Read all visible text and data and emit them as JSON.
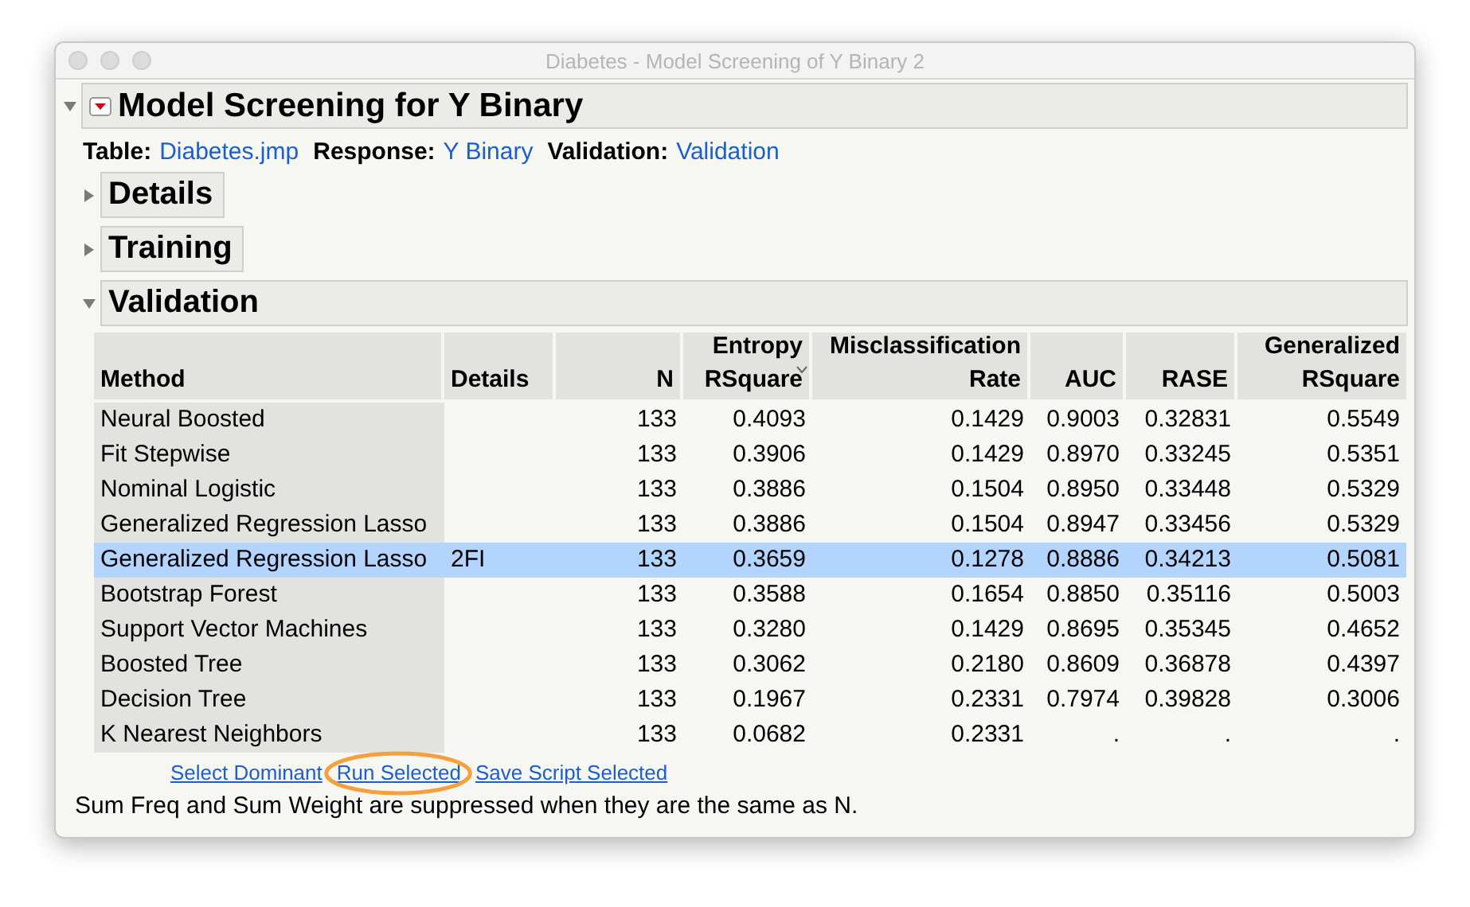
{
  "window": {
    "title": "Diabetes - Model Screening of Y Binary 2"
  },
  "report": {
    "title": "Model Screening for Y Binary",
    "info": [
      {
        "label": "Table:",
        "value": "Diabetes.jmp"
      },
      {
        "label": "Response:",
        "value": "Y Binary"
      },
      {
        "label": "Validation:",
        "value": "Validation"
      }
    ],
    "sections": [
      {
        "title": "Details",
        "expanded": false
      },
      {
        "title": "Training",
        "expanded": false
      },
      {
        "title": "Validation",
        "expanded": true
      }
    ]
  },
  "table": {
    "columns": [
      {
        "lines": [
          "Method"
        ],
        "sorted": false
      },
      {
        "lines": [
          "Details"
        ],
        "sorted": false
      },
      {
        "lines": [
          "N"
        ],
        "sorted": false
      },
      {
        "lines": [
          "Entropy",
          "RSquare"
        ],
        "sorted": true
      },
      {
        "lines": [
          "Misclassification",
          "Rate"
        ],
        "sorted": false
      },
      {
        "lines": [
          "AUC"
        ],
        "sorted": false
      },
      {
        "lines": [
          "RASE"
        ],
        "sorted": false
      },
      {
        "lines": [
          "Generalized",
          "RSquare"
        ],
        "sorted": false
      }
    ],
    "rows": [
      {
        "selected": false,
        "cells": [
          "Neural Boosted",
          "",
          "133",
          "0.4093",
          "0.1429",
          "0.9003",
          "0.32831",
          "0.5549"
        ]
      },
      {
        "selected": false,
        "cells": [
          "Fit Stepwise",
          "",
          "133",
          "0.3906",
          "0.1429",
          "0.8970",
          "0.33245",
          "0.5351"
        ]
      },
      {
        "selected": false,
        "cells": [
          "Nominal Logistic",
          "",
          "133",
          "0.3886",
          "0.1504",
          "0.8950",
          "0.33448",
          "0.5329"
        ]
      },
      {
        "selected": false,
        "cells": [
          "Generalized Regression Lasso",
          "",
          "133",
          "0.3886",
          "0.1504",
          "0.8947",
          "0.33456",
          "0.5329"
        ]
      },
      {
        "selected": true,
        "cells": [
          "Generalized Regression Lasso",
          "2FI",
          "133",
          "0.3659",
          "0.1278",
          "0.8886",
          "0.34213",
          "0.5081"
        ]
      },
      {
        "selected": false,
        "cells": [
          "Bootstrap Forest",
          "",
          "133",
          "0.3588",
          "0.1654",
          "0.8850",
          "0.35116",
          "0.5003"
        ]
      },
      {
        "selected": false,
        "cells": [
          "Support Vector Machines",
          "",
          "133",
          "0.3280",
          "0.1429",
          "0.8695",
          "0.35345",
          "0.4652"
        ]
      },
      {
        "selected": false,
        "cells": [
          "Boosted Tree",
          "",
          "133",
          "0.3062",
          "0.2180",
          "0.8609",
          "0.36878",
          "0.4397"
        ]
      },
      {
        "selected": false,
        "cells": [
          "Decision Tree",
          "",
          "133",
          "0.1967",
          "0.2331",
          "0.7974",
          "0.39828",
          "0.3006"
        ]
      },
      {
        "selected": false,
        "cells": [
          "K Nearest Neighbors",
          "",
          "133",
          "0.0682",
          "0.2331",
          ".",
          ".",
          "."
        ]
      }
    ]
  },
  "links": [
    {
      "label": "Select Dominant",
      "highlighted": false
    },
    {
      "label": "Run Selected",
      "highlighted": true
    },
    {
      "label": "Save Script Selected",
      "highlighted": false
    }
  ],
  "note": "Sum Freq and Sum Weight are suppressed when they are the same as N."
}
